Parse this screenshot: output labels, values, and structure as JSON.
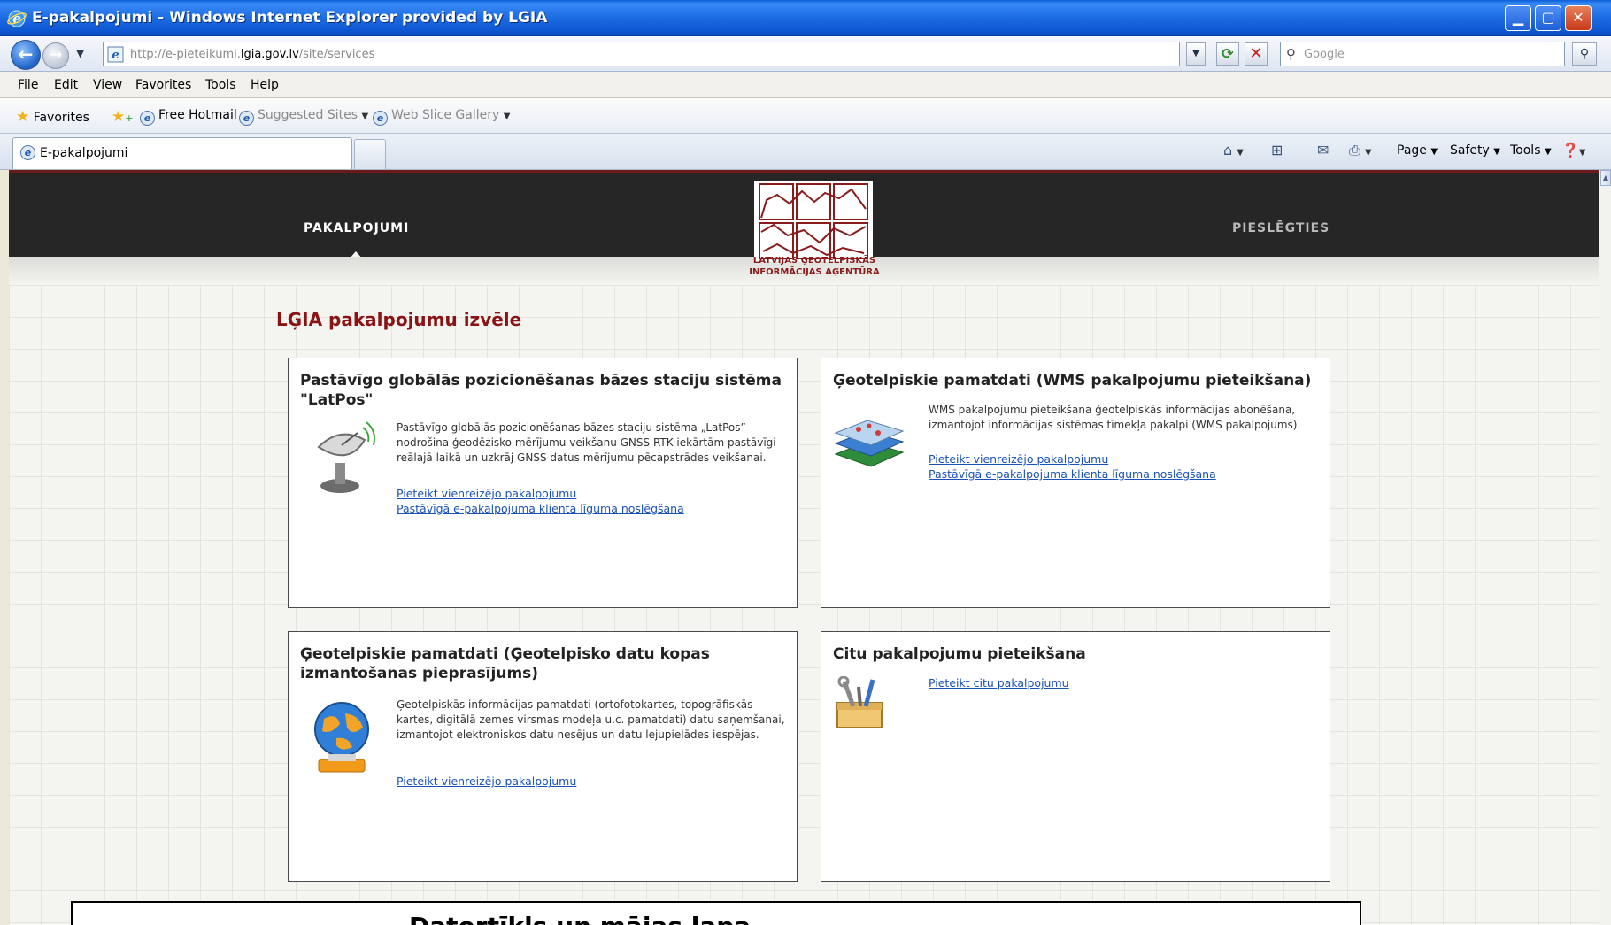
{
  "window": {
    "title": "E-pakalpojumi - Windows Internet Explorer provided by LGIA"
  },
  "address_bar": {
    "url_prefix": "http://e-pieteikumi.",
    "url_domain": "lgia.gov.lv",
    "url_path": "/site/services",
    "search_placeholder": "Google"
  },
  "menu": [
    "File",
    "Edit",
    "View",
    "Favorites",
    "Tools",
    "Help"
  ],
  "favorites_bar": {
    "favorites_label": "Favorites",
    "free_hotmail": "Free Hotmail",
    "suggested_sites": "Suggested Sites",
    "web_slice_gallery": "Web Slice Gallery"
  },
  "tabs": {
    "active_label": "E-pakalpojumi"
  },
  "command_bar": {
    "page": "Page",
    "safety": "Safety",
    "tools": "Tools"
  },
  "site": {
    "nav_left": "PAKALPOJUMI",
    "nav_right": "PIESLĒGTIES",
    "logo_line1": "LATVIJAS ĢEOTELPISKĀS",
    "logo_line2": "INFORMĀCIJAS AĢENTŪRA",
    "page_title": "LĢIA pakalpojumu izvēle"
  },
  "cards": [
    {
      "title": "Pastāvīgo globālās pozicionēšanas bāzes staciju sistēma \"LatPos\"",
      "description": "Pastāvīgo globālās pozicionēšanas bāzes staciju sistēma „LatPos” nodrošina ģeodēzisko mērījumu veikšanu GNSS RTK iekārtām pastāvīgi reālajā laikā un uzkrāj GNSS datus mērījumu pēcapstrādes veikšanai.",
      "link1": "Pieteikt vienreizējo pakalpojumu",
      "link2": "Pastāvīgā e-pakalpojuma klienta līguma noslēgšana"
    },
    {
      "title": "Ģeotelpiskie pamatdati (WMS pakalpojumu pieteikšana)",
      "description": "WMS pakalpojumu pieteikšana ģeotelpiskās informācijas abonēšana, izmantojot informācijas sistēmas tīmekļa pakalpi (WMS pakalpojums).",
      "link1": "Pieteikt vienreizējo pakalpojumu",
      "link2": "Pastāvīgā e-pakalpojuma klienta līguma noslēgšana"
    },
    {
      "title": "Ģeotelpiskie pamatdati (Ģeotelpisko datu kopas izmantošanas pieprasījums)",
      "description": "Ģeotelpiskās informācijas pamatdati (ortofotokartes, topogrāfiskās kartes, digitālā zemes virsmas modeļa u.c. pamatdati) datu saņemšanai, izmantojot elektroniskos datu nesējus un datu lejupielādes iespējas.",
      "link1": "Pieteikt vienreizējo pakalpojumu"
    },
    {
      "title": "Citu pakalpojumu pieteikšana",
      "link1": "Pieteikt citu pakalpojumu"
    }
  ],
  "caption": "Datortīkls un mājas lapa"
}
